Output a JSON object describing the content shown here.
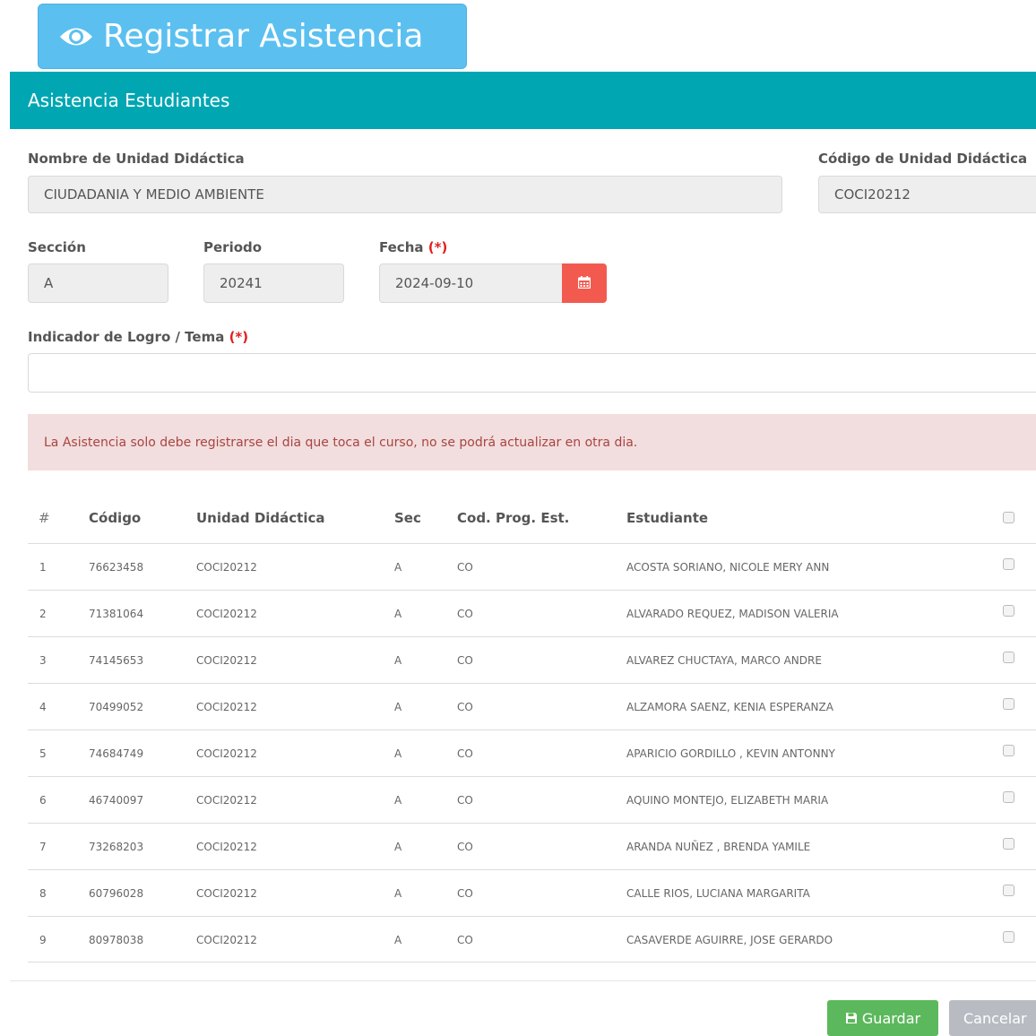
{
  "register_button": {
    "label": "Registrar Asistencia",
    "icon": "eye-icon"
  },
  "modal": {
    "title": "Asistencia Estudiantes"
  },
  "form": {
    "unidad_nombre": {
      "label": "Nombre de Unidad Didáctica",
      "value": "CIUDADANIA Y MEDIO AMBIENTE"
    },
    "unidad_codigo": {
      "label": "Código de Unidad Didáctica",
      "value": "COCI20212"
    },
    "seccion": {
      "label": "Sección",
      "value": "A"
    },
    "periodo": {
      "label": "Periodo",
      "value": "20241"
    },
    "fecha": {
      "label": "Fecha",
      "required_mark": "(*)",
      "value": "2024-09-10",
      "icon": "calendar-icon"
    },
    "indicador": {
      "label": "Indicador de Logro / Tema",
      "required_mark": "(*)",
      "value": ""
    }
  },
  "alert": {
    "text": "La Asistencia solo debe registrarse el dia que toca el curso, no se podrá actualizar en otra dia."
  },
  "table": {
    "headers": [
      "#",
      "Código",
      "Unidad Didáctica",
      "Sec",
      "Cod. Prog. Est.",
      "Estudiante"
    ],
    "rows": [
      {
        "n": "1",
        "codigo": "76623458",
        "unidad": "COCI20212",
        "sec": "A",
        "prog": "CO",
        "estudiante": "ACOSTA SORIANO, NICOLE MERY ANN"
      },
      {
        "n": "2",
        "codigo": "71381064",
        "unidad": "COCI20212",
        "sec": "A",
        "prog": "CO",
        "estudiante": "ALVARADO REQUEZ, MADISON VALERIA"
      },
      {
        "n": "3",
        "codigo": "74145653",
        "unidad": "COCI20212",
        "sec": "A",
        "prog": "CO",
        "estudiante": "ALVAREZ CHUCTAYA, MARCO ANDRE"
      },
      {
        "n": "4",
        "codigo": "70499052",
        "unidad": "COCI20212",
        "sec": "A",
        "prog": "CO",
        "estudiante": "ALZAMORA SAENZ, KENIA ESPERANZA"
      },
      {
        "n": "5",
        "codigo": "74684749",
        "unidad": "COCI20212",
        "sec": "A",
        "prog": "CO",
        "estudiante": "APARICIO GORDILLO , KEVIN ANTONNY"
      },
      {
        "n": "6",
        "codigo": "46740097",
        "unidad": "COCI20212",
        "sec": "A",
        "prog": "CO",
        "estudiante": "AQUINO MONTEJO, ELIZABETH MARIA"
      },
      {
        "n": "7",
        "codigo": "73268203",
        "unidad": "COCI20212",
        "sec": "A",
        "prog": "CO",
        "estudiante": "ARANDA NUÑEZ , BRENDA YAMILE"
      },
      {
        "n": "8",
        "codigo": "60796028",
        "unidad": "COCI20212",
        "sec": "A",
        "prog": "CO",
        "estudiante": "CALLE RIOS, LUCIANA MARGARITA"
      },
      {
        "n": "9",
        "codigo": "80978038",
        "unidad": "COCI20212",
        "sec": "A",
        "prog": "CO",
        "estudiante": "CASAVERDE AGUIRRE, JOSE GERARDO"
      }
    ]
  },
  "buttons": {
    "save": "Guardar",
    "save_icon": "floppy-disk-icon",
    "cancel": "Cancelar"
  },
  "colors": {
    "header": "#00a7b3",
    "register": "#5bc0f0",
    "calendar": "#f25a50",
    "save": "#5cb85c",
    "cancel": "#b8bcc2",
    "alert_bg": "#f2dede",
    "alert_text": "#a94442"
  }
}
